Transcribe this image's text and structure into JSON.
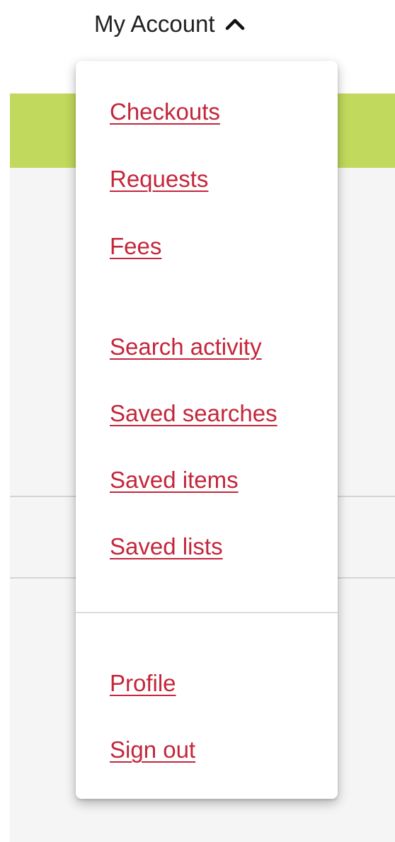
{
  "header": {
    "account_label": "My Account"
  },
  "icons": {
    "toggle": "chevron-up-icon"
  },
  "colors": {
    "link": "#c4263a",
    "banner": "#c1d95c",
    "page_background": "#f5f5f5",
    "menu_background": "#ffffff"
  },
  "menu": {
    "items": [
      {
        "label": "Checkouts"
      },
      {
        "label": "Requests"
      },
      {
        "label": "Fees"
      },
      {
        "label": "Search activity"
      },
      {
        "label": "Saved searches"
      },
      {
        "label": "Saved items"
      },
      {
        "label": "Saved lists"
      },
      {
        "label": "Profile"
      },
      {
        "label": "Sign out"
      }
    ]
  }
}
